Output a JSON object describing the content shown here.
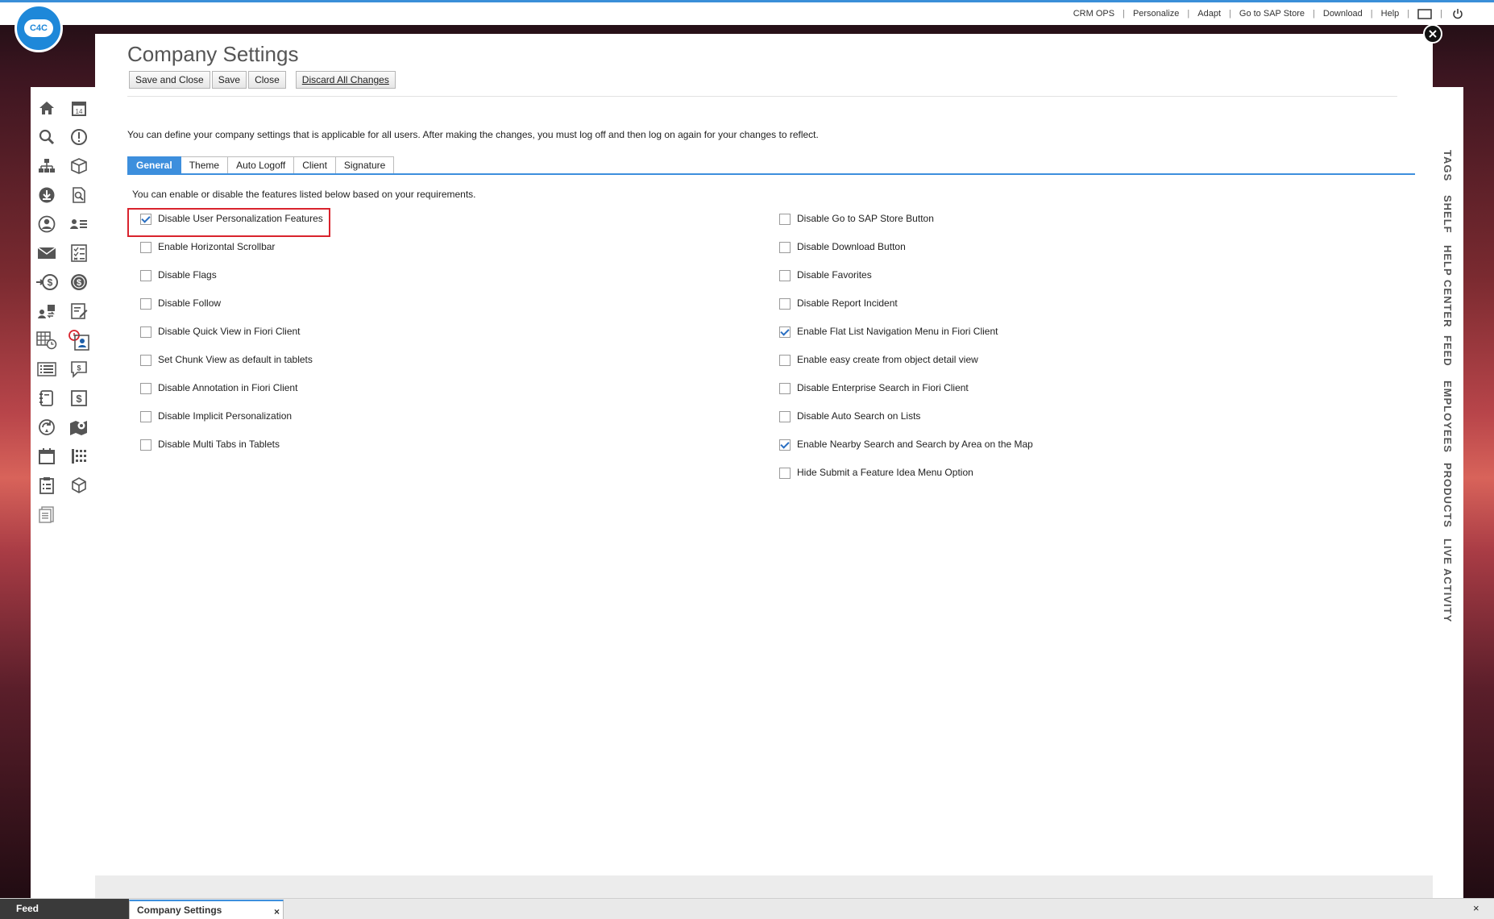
{
  "logo": {
    "text": "C4C"
  },
  "topbar": {
    "links": [
      "CRM OPS",
      "Personalize",
      "Adapt",
      "Go to SAP Store",
      "Download",
      "Help"
    ],
    "separator": "|",
    "icons": [
      "screen-icon",
      "power-icon"
    ]
  },
  "page": {
    "title": "Company Settings",
    "toolbar": {
      "save_close": "Save and Close",
      "save": "Save",
      "close": "Close",
      "discard": "Discard All Changes"
    },
    "intro": "You can define your company settings that is applicable for all users. After making the changes, you must log off and then log on again for your changes to reflect.",
    "tabs": [
      "General",
      "Theme",
      "Auto Logoff",
      "Client",
      "Signature"
    ],
    "active_tab": "General",
    "subintro": "You can enable or disable the features listed below based on your requirements.",
    "left_options": [
      {
        "label": "Disable User Personalization Features",
        "checked": true
      },
      {
        "label": "Enable Horizontal Scrollbar",
        "checked": false
      },
      {
        "label": "Disable Flags",
        "checked": false
      },
      {
        "label": "Disable Follow",
        "checked": false
      },
      {
        "label": "Disable Quick View in Fiori Client",
        "checked": false
      },
      {
        "label": "Set Chunk View as default in tablets",
        "checked": false
      },
      {
        "label": "Disable Annotation in Fiori Client",
        "checked": false
      },
      {
        "label": "Disable Implicit Personalization",
        "checked": false
      },
      {
        "label": "Disable Multi Tabs in Tablets",
        "checked": false
      }
    ],
    "right_options": [
      {
        "label": "Disable Go to SAP Store Button",
        "checked": false
      },
      {
        "label": "Disable Download Button",
        "checked": false
      },
      {
        "label": "Disable Favorites",
        "checked": false
      },
      {
        "label": "Disable Report Incident",
        "checked": false
      },
      {
        "label": "Enable Flat List Navigation Menu in Fiori Client",
        "checked": true
      },
      {
        "label": "Enable easy create from object detail view",
        "checked": false
      },
      {
        "label": "Disable Enterprise Search in Fiori Client",
        "checked": false
      },
      {
        "label": "Disable Auto Search on Lists",
        "checked": false
      },
      {
        "label": "Enable Nearby Search and Search by Area on the Map",
        "checked": true
      },
      {
        "label": "Hide Submit a Feature Idea Menu Option",
        "checked": false
      }
    ]
  },
  "leftnav_icons": [
    "home-icon",
    "calendar-14-icon",
    "search-icon",
    "alert-icon",
    "org-chart-icon",
    "product-box-icon",
    "download-icon",
    "document-search-icon",
    "person-icon",
    "contacts-list-icon",
    "mail-icon",
    "checklist-icon",
    "money-transfer-icon",
    "dollar-coin-icon",
    "exchange-icon",
    "edit-form-icon",
    "table-clock-icon",
    "timesheet-icon",
    "list-icon",
    "chat-dollar-icon",
    "notebook-icon",
    "invoice-dollar-icon",
    "refresh-globe-icon",
    "map-pin-icon",
    "calendar-icon",
    "calculator-icon",
    "clipboard-icon",
    "cube-icon",
    "report-icon"
  ],
  "right_rail": [
    "TAGS",
    "SHELF",
    "HELP CENTER",
    "FEED",
    "EMPLOYEES",
    "PRODUCTS",
    "LIVE ACTIVITY"
  ],
  "taskbar": {
    "feed": "Feed",
    "open_tab": "Company Settings",
    "close_glyph": "×"
  },
  "colors": {
    "accent": "#3d8fdd",
    "highlight": "#d9232d",
    "brand": "#1e88d9"
  }
}
